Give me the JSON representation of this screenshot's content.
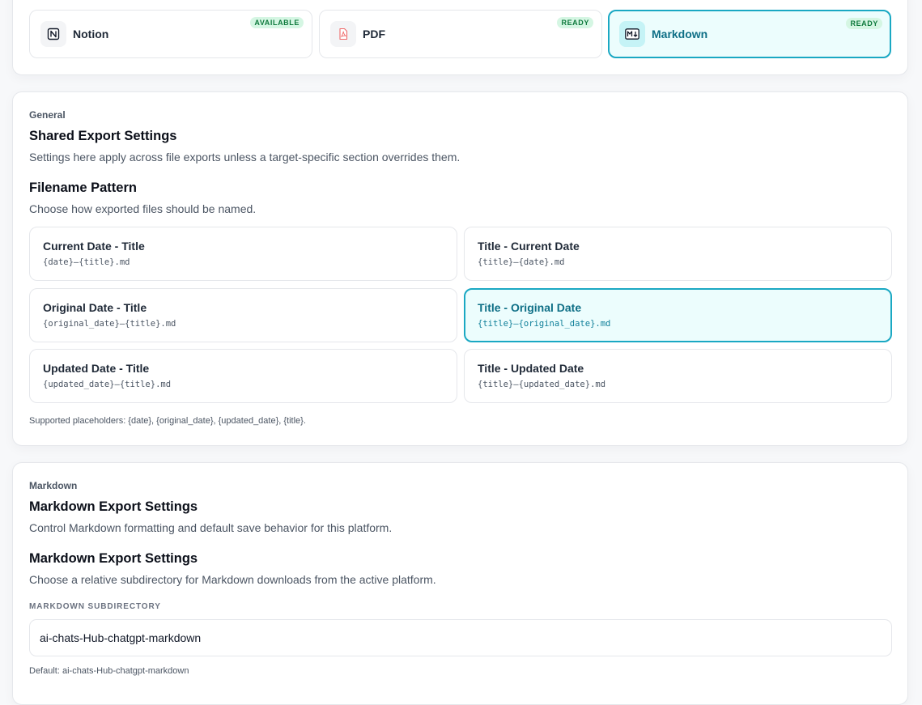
{
  "targets": [
    {
      "name": "Notion",
      "badge": "AVAILABLE",
      "icon": "notion-icon"
    },
    {
      "name": "PDF",
      "badge": "READY",
      "icon": "pdf-icon"
    },
    {
      "name": "Markdown",
      "badge": "READY",
      "icon": "markdown-icon",
      "selected": true
    }
  ],
  "general": {
    "eyebrow": "General",
    "title": "Shared Export Settings",
    "description": "Settings here apply across file exports unless a target-specific section overrides them.",
    "filename": {
      "title": "Filename Pattern",
      "description": "Choose how exported files should be named.",
      "options": [
        {
          "label": "Current Date - Title",
          "pattern": "{date}—{title}.md"
        },
        {
          "label": "Title - Current Date",
          "pattern": "{title}—{date}.md"
        },
        {
          "label": "Original Date - Title",
          "pattern": "{original_date}—{title}.md"
        },
        {
          "label": "Title - Original Date",
          "pattern": "{title}—{original_date}.md",
          "selected": true
        },
        {
          "label": "Updated Date - Title",
          "pattern": "{updated_date}—{title}.md"
        },
        {
          "label": "Title - Updated Date",
          "pattern": "{title}—{updated_date}.md"
        }
      ],
      "hint": "Supported placeholders: {date}, {original_date}, {updated_date}, {title}."
    }
  },
  "markdown": {
    "eyebrow": "Markdown",
    "title": "Markdown Export Settings",
    "description": "Control Markdown formatting and default save behavior for this platform.",
    "subsection_title": "Markdown Export Settings",
    "subsection_description": "Choose a relative subdirectory for Markdown downloads from the active platform.",
    "subdir_label": "MARKDOWN SUBDIRECTORY",
    "subdir_value": "ai-chats-Hub-chatgpt-markdown",
    "default_hint": "Default: ai-chats-Hub-chatgpt-markdown"
  },
  "colors": {
    "accent": "#1aa8c3",
    "accent_bg": "#ecfdfd",
    "badge_text": "#0f7a3d",
    "badge_bg": "#d5f6e3"
  }
}
